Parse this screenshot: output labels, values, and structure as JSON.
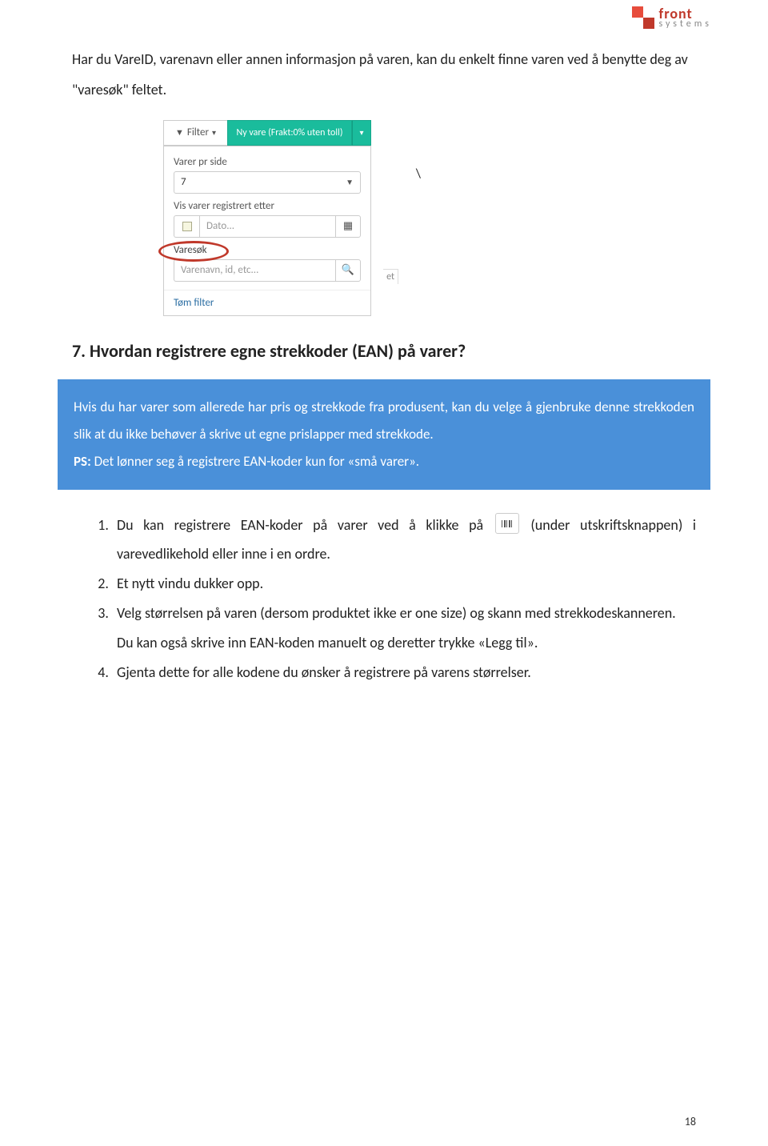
{
  "logo": {
    "line1": "front",
    "line2": "systems"
  },
  "intro": "Har du VareID, varenavn eller annen informasjon på varen, kan du enkelt finne varen ved å benytte deg av \"varesøk\" feltet.",
  "panel": {
    "filter_label": "Filter",
    "nyvare_label": "Ny vare (Frakt:0% uten toll)",
    "varer_pr_side_label": "Varer pr side",
    "varer_pr_side_value": "7",
    "vis_varer_label": "Vis varer registrert etter",
    "dato_placeholder": "Dato...",
    "varesok_label": "Varesøk",
    "varesok_placeholder": "Varenavn, id, etc...",
    "tom_filter": "Tøm filter",
    "stray_et": "et"
  },
  "heading": "7. Hvordan registrere egne strekkoder (EAN) på varer?",
  "info_box": {
    "p1": "Hvis du har varer som allerede har pris og strekkode fra produsent, kan du velge å gjenbruke denne strekkoden slik at du ikke behøver å skrive ut egne prislapper med strekkode.",
    "ps_label": "PS:",
    "ps_text": " Det lønner seg å registrere EAN-koder kun for «små varer»."
  },
  "steps": {
    "s1a": "Du kan registrere EAN-koder på varer ved å klikke på ",
    "s1b": " (under utskriftsknappen) i varevedlikehold eller inne i en ordre.",
    "s2": "Et nytt vindu dukker opp.",
    "s3a": "Velg størrelsen på varen (dersom produktet ikke er one size) og skann med strekkodeskanneren.",
    "s3b": "Du kan også skrive inn EAN-koden manuelt og deretter trykke «Legg til».",
    "s4": "Gjenta dette for alle kodene du ønsker å registrere på varens størrelser."
  },
  "page_number": "18"
}
